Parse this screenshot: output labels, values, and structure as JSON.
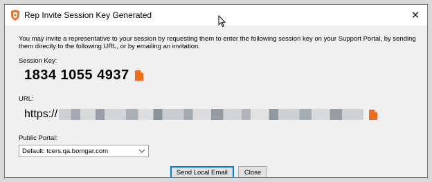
{
  "window": {
    "title": "Rep Invite Session Key Generated",
    "close_glyph": "✕",
    "brand_color": "#e8772e"
  },
  "intro": {
    "text": "You may invite a representative to your session by requesting them to enter the following session key on your Support Portal, by sending them directly to the following URL, or by emailing an invitation."
  },
  "session_key": {
    "label": "Session Key:",
    "value": "1834 1055 4937",
    "copy_icon": "copy-icon"
  },
  "url": {
    "label": "URL:",
    "value": "https://",
    "copy_icon": "copy-icon"
  },
  "portal": {
    "label": "Public Portal:",
    "selected": "Default: tcers.qa.bomgar.com"
  },
  "buttons": {
    "send_email": "Send Local Email",
    "close": "Close"
  }
}
